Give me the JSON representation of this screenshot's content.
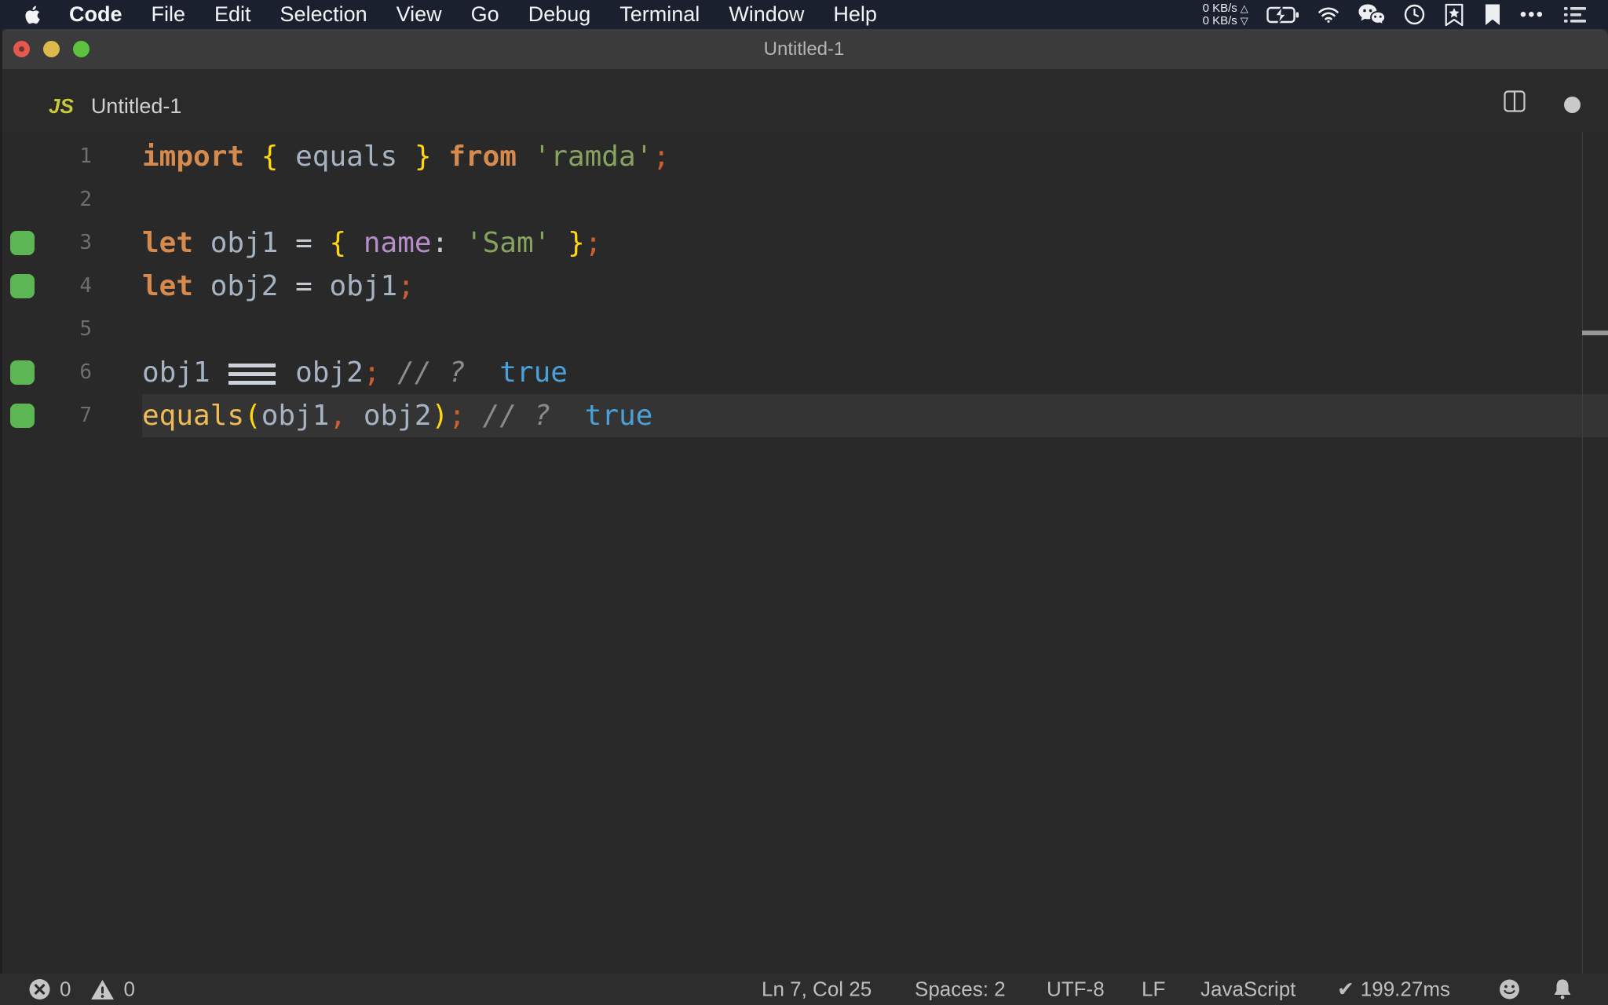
{
  "menu_bar": {
    "items": [
      {
        "label": "Code",
        "bold": true
      },
      {
        "label": "File",
        "bold": false
      },
      {
        "label": "Edit",
        "bold": false
      },
      {
        "label": "Selection",
        "bold": false
      },
      {
        "label": "View",
        "bold": false
      },
      {
        "label": "Go",
        "bold": false
      },
      {
        "label": "Debug",
        "bold": false
      },
      {
        "label": "Terminal",
        "bold": false
      },
      {
        "label": "Window",
        "bold": false
      },
      {
        "label": "Help",
        "bold": false
      }
    ],
    "tray": {
      "upload_label": "0 KB/s",
      "download_label": "0 KB/s",
      "up_arrow": "△",
      "down_arrow": "▽",
      "ellipsis": "•••"
    }
  },
  "window": {
    "title": "Untitled-1"
  },
  "tab": {
    "file_type_badge": "JS",
    "label": "Untitled-1"
  },
  "editor": {
    "lines": [
      {
        "n": "1",
        "quokka": false,
        "current": false,
        "tokens": [
          [
            "kw",
            "import"
          ],
          [
            "pl",
            " "
          ],
          [
            "br",
            "{"
          ],
          [
            "pl",
            " "
          ],
          [
            "id",
            "equals"
          ],
          [
            "pl",
            " "
          ],
          [
            "br",
            "}"
          ],
          [
            "pl",
            " "
          ],
          [
            "kw",
            "from"
          ],
          [
            "pl",
            " "
          ],
          [
            "str",
            "'ramda'"
          ],
          [
            "sm",
            ";"
          ]
        ]
      },
      {
        "n": "2",
        "quokka": false,
        "current": false,
        "tokens": []
      },
      {
        "n": "3",
        "quokka": true,
        "current": false,
        "tokens": [
          [
            "kw",
            "let"
          ],
          [
            "pl",
            " "
          ],
          [
            "id",
            "obj1"
          ],
          [
            "pl",
            " "
          ],
          [
            "op",
            "="
          ],
          [
            "pl",
            " "
          ],
          [
            "br",
            "{"
          ],
          [
            "pl",
            " "
          ],
          [
            "pr",
            "name"
          ],
          [
            "op",
            ":"
          ],
          [
            "pl",
            " "
          ],
          [
            "str",
            "'Sam'"
          ],
          [
            "pl",
            " "
          ],
          [
            "br",
            "}"
          ],
          [
            "sm",
            ";"
          ]
        ]
      },
      {
        "n": "4",
        "quokka": true,
        "current": false,
        "tokens": [
          [
            "kw",
            "let"
          ],
          [
            "pl",
            " "
          ],
          [
            "id",
            "obj2"
          ],
          [
            "pl",
            " "
          ],
          [
            "op",
            "="
          ],
          [
            "pl",
            " "
          ],
          [
            "id",
            "obj1"
          ],
          [
            "sm",
            ";"
          ]
        ]
      },
      {
        "n": "5",
        "quokka": false,
        "current": false,
        "tokens": []
      },
      {
        "n": "6",
        "quokka": true,
        "current": false,
        "tokens": [
          [
            "id",
            "obj1"
          ],
          [
            "pl",
            " "
          ],
          [
            "lig",
            "==="
          ],
          [
            "pl",
            " "
          ],
          [
            "id",
            "obj2"
          ],
          [
            "sm",
            ";"
          ],
          [
            "pl",
            " "
          ],
          [
            "cm",
            "// ?"
          ],
          [
            "pl",
            "  "
          ],
          [
            "out",
            "true"
          ]
        ]
      },
      {
        "n": "7",
        "quokka": true,
        "current": true,
        "tokens": [
          [
            "fn",
            "equals"
          ],
          [
            "br",
            "("
          ],
          [
            "id",
            "obj1"
          ],
          [
            "sm",
            ","
          ],
          [
            "pl",
            " "
          ],
          [
            "id",
            "obj2"
          ],
          [
            "br",
            ")"
          ],
          [
            "sm",
            ";"
          ],
          [
            "pl",
            " "
          ],
          [
            "cm",
            "// ?"
          ],
          [
            "pl",
            "  "
          ],
          [
            "out",
            "true"
          ]
        ]
      }
    ]
  },
  "status_bar": {
    "errors": "0",
    "warnings": "0",
    "cursor": "Ln 7, Col 25",
    "indent": "Spaces: 2",
    "encoding": "UTF-8",
    "eol": "LF",
    "language": "JavaScript",
    "check": "✔",
    "time": "199.27ms"
  },
  "colors": {
    "menubar_bg": "#1b202e",
    "titlebar_bg": "#3b3b3b",
    "editor_bg": "#292929",
    "current_line_bg": "#343434",
    "statusbar_bg": "#2d2d2e",
    "quokka_green": "#5cb654",
    "keyword_orange": "#d68a4e",
    "brace_yellow": "#ffd612",
    "string_green": "#87a35e",
    "property_purple": "#b88dc9",
    "output_blue": "#4aa0d9",
    "semicolon_orange": "#cc5f31"
  }
}
